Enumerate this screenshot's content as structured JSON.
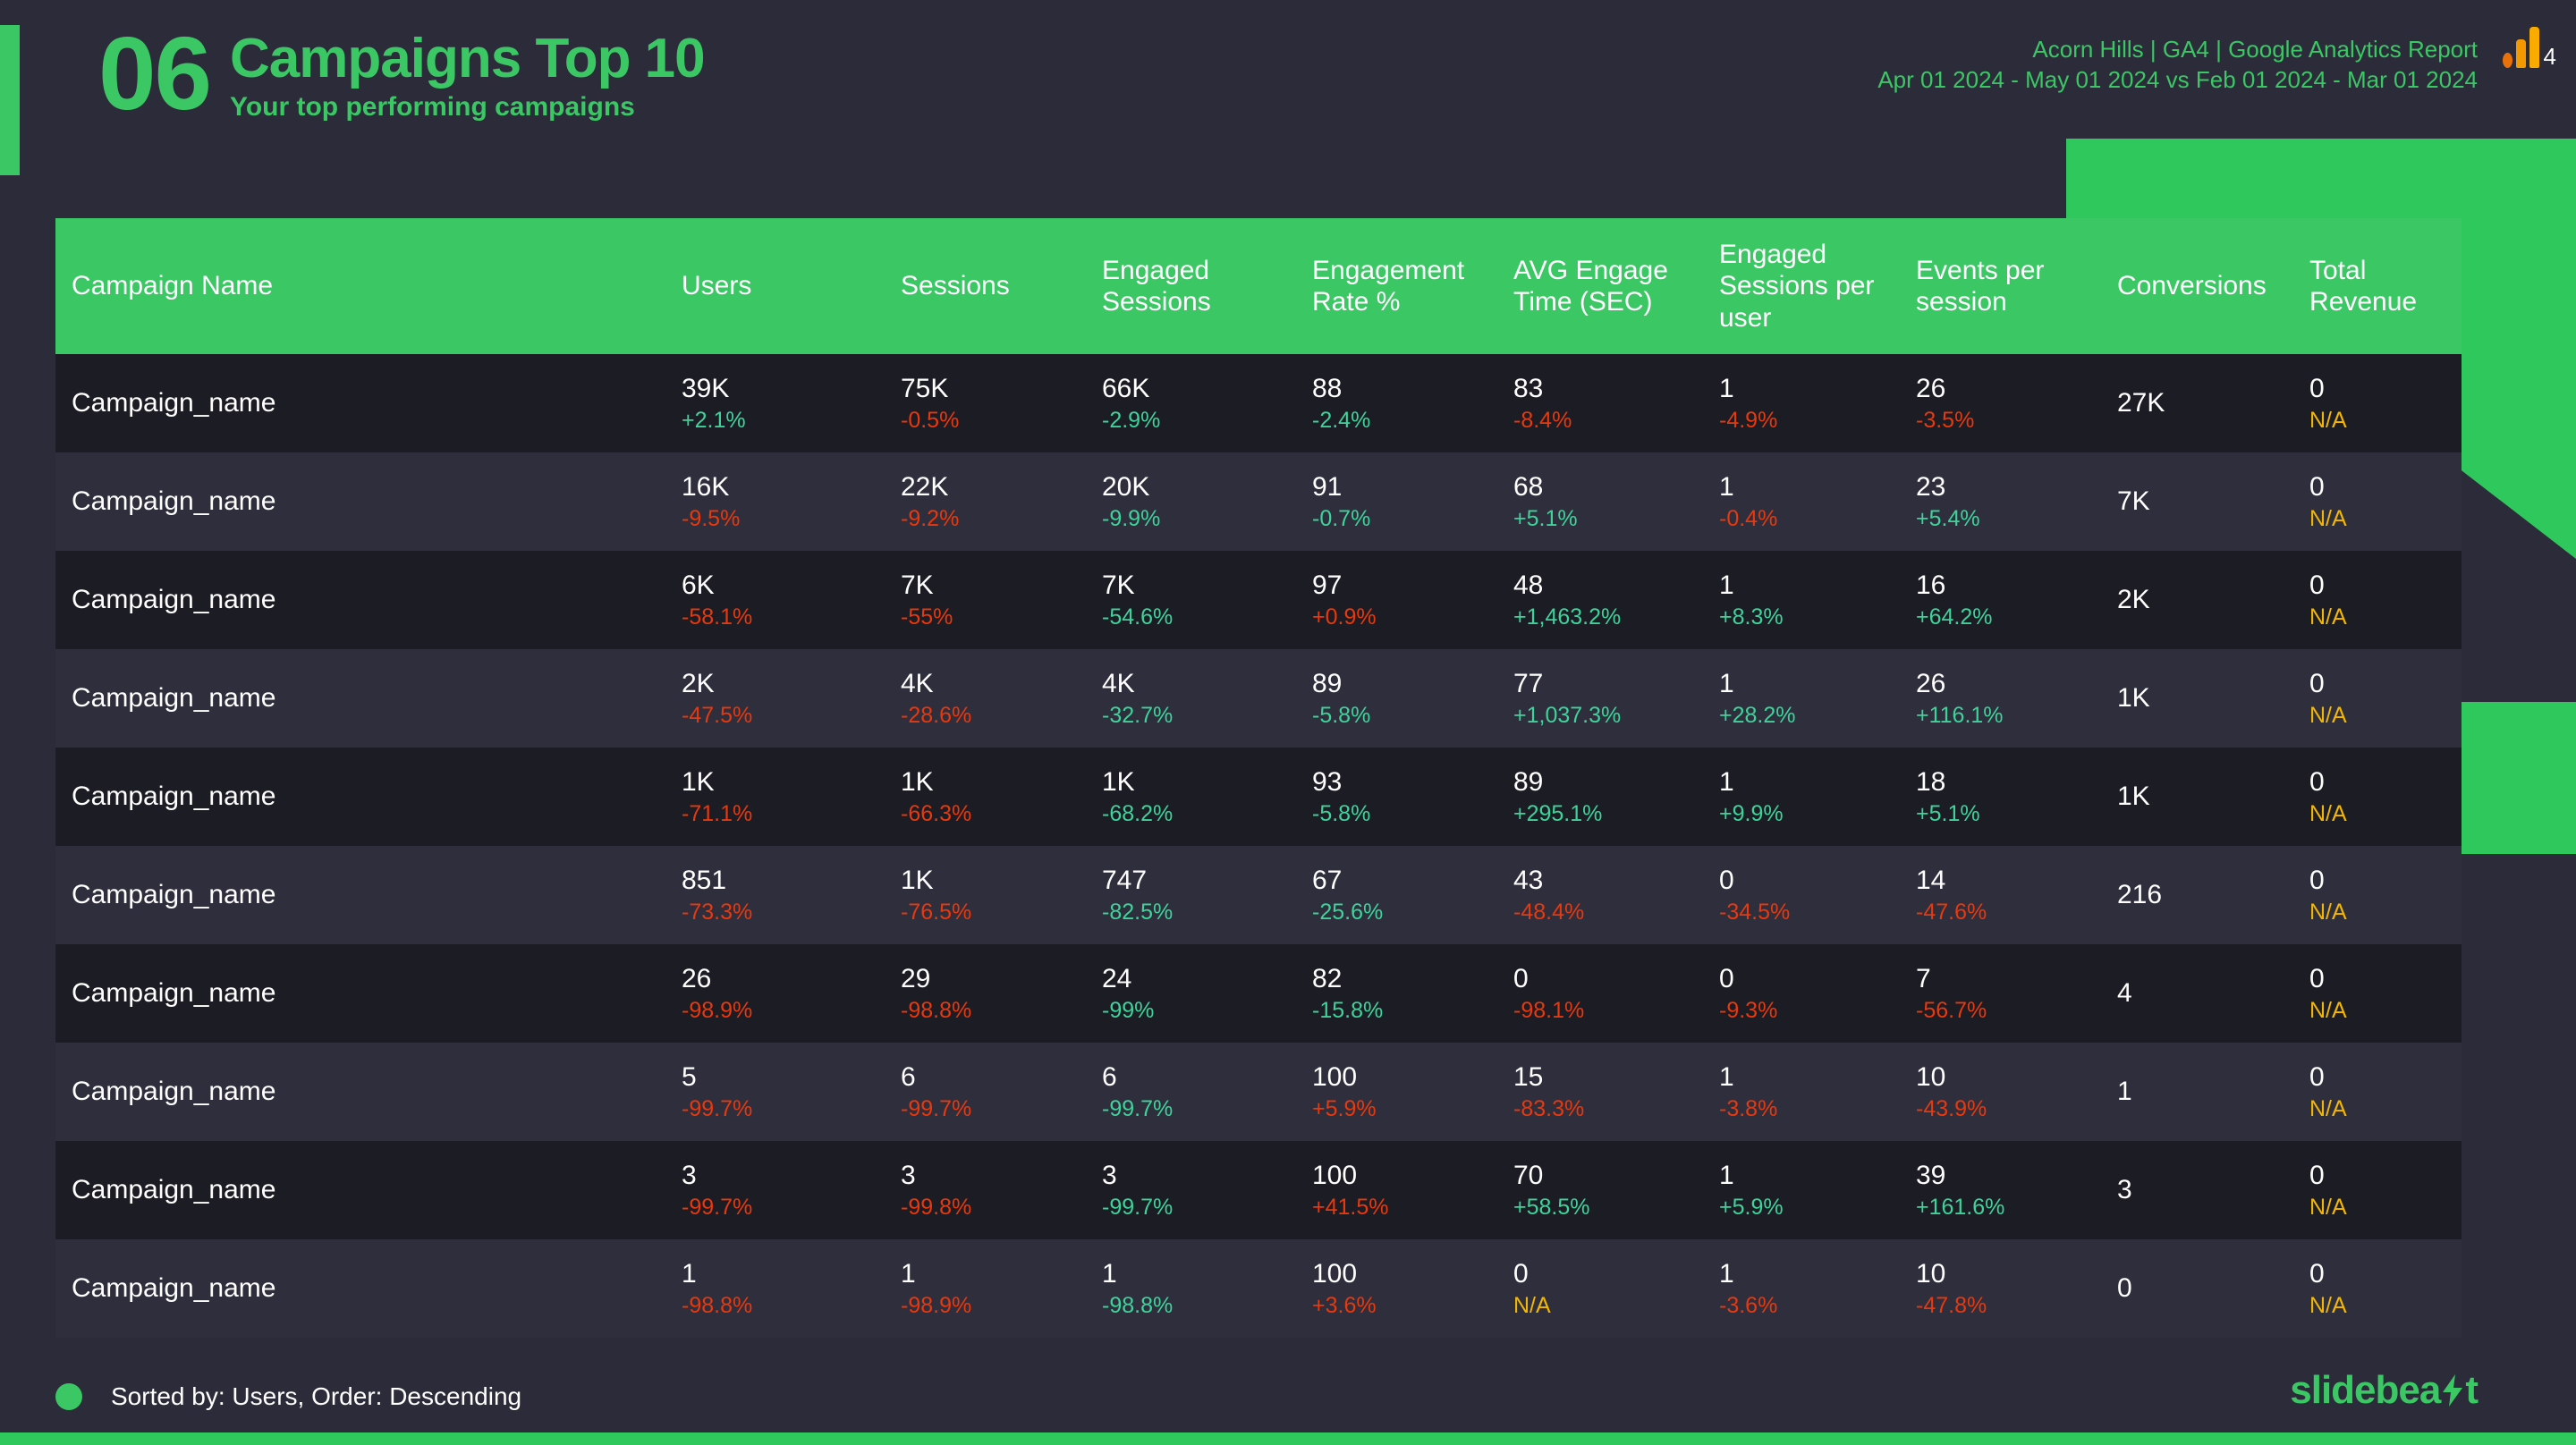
{
  "header": {
    "section_number": "06",
    "title": "Campaigns Top 10",
    "subtitle": "Your top performing campaigns",
    "account_line": "Acorn Hills | GA4 | Google Analytics Report",
    "date_range_line": "Apr 01 2024 - May 01 2024 vs Feb 01 2024 - Mar 01 2024",
    "logo_badge": "4",
    "logo_name": "ga4-logo"
  },
  "table": {
    "columns": [
      "Campaign Name",
      "Users",
      "Sessions",
      "Engaged Sessions",
      "Engagement Rate %",
      "AVG Engage Time (SEC)",
      "Engaged Sessions per user",
      "Events per session",
      "Conversions",
      "Total Revenue"
    ],
    "rows": [
      {
        "name": "Campaign_name",
        "cells": [
          {
            "value": "39K",
            "delta": "+2.1%",
            "dir": "up"
          },
          {
            "value": "75K",
            "delta": "-0.5%",
            "dir": "down"
          },
          {
            "value": "66K",
            "delta": "-2.9%",
            "dir": "up"
          },
          {
            "value": "88",
            "delta": "-2.4%",
            "dir": "up"
          },
          {
            "value": "83",
            "delta": "-8.4%",
            "dir": "down"
          },
          {
            "value": "1",
            "delta": "-4.9%",
            "dir": "down"
          },
          {
            "value": "26",
            "delta": "-3.5%",
            "dir": "down"
          },
          {
            "value": "27K",
            "delta": "",
            "dir": "none"
          },
          {
            "value": "0",
            "delta": "N/A",
            "dir": "na"
          }
        ]
      },
      {
        "name": "Campaign_name",
        "cells": [
          {
            "value": "16K",
            "delta": "-9.5%",
            "dir": "down"
          },
          {
            "value": "22K",
            "delta": "-9.2%",
            "dir": "down"
          },
          {
            "value": "20K",
            "delta": "-9.9%",
            "dir": "up"
          },
          {
            "value": "91",
            "delta": "-0.7%",
            "dir": "up"
          },
          {
            "value": "68",
            "delta": "+5.1%",
            "dir": "up"
          },
          {
            "value": "1",
            "delta": "-0.4%",
            "dir": "down"
          },
          {
            "value": "23",
            "delta": "+5.4%",
            "dir": "up"
          },
          {
            "value": "7K",
            "delta": "",
            "dir": "none"
          },
          {
            "value": "0",
            "delta": "N/A",
            "dir": "na"
          }
        ]
      },
      {
        "name": "Campaign_name",
        "cells": [
          {
            "value": "6K",
            "delta": "-58.1%",
            "dir": "down"
          },
          {
            "value": "7K",
            "delta": "-55%",
            "dir": "down"
          },
          {
            "value": "7K",
            "delta": "-54.6%",
            "dir": "up"
          },
          {
            "value": "97",
            "delta": "+0.9%",
            "dir": "down"
          },
          {
            "value": "48",
            "delta": "+1,463.2%",
            "dir": "up"
          },
          {
            "value": "1",
            "delta": "+8.3%",
            "dir": "up"
          },
          {
            "value": "16",
            "delta": "+64.2%",
            "dir": "up"
          },
          {
            "value": "2K",
            "delta": "",
            "dir": "none"
          },
          {
            "value": "0",
            "delta": "N/A",
            "dir": "na"
          }
        ]
      },
      {
        "name": "Campaign_name",
        "cells": [
          {
            "value": "2K",
            "delta": "-47.5%",
            "dir": "down"
          },
          {
            "value": "4K",
            "delta": "-28.6%",
            "dir": "down"
          },
          {
            "value": "4K",
            "delta": "-32.7%",
            "dir": "up"
          },
          {
            "value": "89",
            "delta": "-5.8%",
            "dir": "up"
          },
          {
            "value": "77",
            "delta": "+1,037.3%",
            "dir": "up"
          },
          {
            "value": "1",
            "delta": "+28.2%",
            "dir": "up"
          },
          {
            "value": "26",
            "delta": "+116.1%",
            "dir": "up"
          },
          {
            "value": "1K",
            "delta": "",
            "dir": "none"
          },
          {
            "value": "0",
            "delta": "N/A",
            "dir": "na"
          }
        ]
      },
      {
        "name": "Campaign_name",
        "cells": [
          {
            "value": "1K",
            "delta": "-71.1%",
            "dir": "down"
          },
          {
            "value": "1K",
            "delta": "-66.3%",
            "dir": "down"
          },
          {
            "value": "1K",
            "delta": "-68.2%",
            "dir": "up"
          },
          {
            "value": "93",
            "delta": "-5.8%",
            "dir": "up"
          },
          {
            "value": "89",
            "delta": "+295.1%",
            "dir": "up"
          },
          {
            "value": "1",
            "delta": "+9.9%",
            "dir": "up"
          },
          {
            "value": "18",
            "delta": "+5.1%",
            "dir": "up"
          },
          {
            "value": "1K",
            "delta": "",
            "dir": "none"
          },
          {
            "value": "0",
            "delta": "N/A",
            "dir": "na"
          }
        ]
      },
      {
        "name": "Campaign_name",
        "cells": [
          {
            "value": "851",
            "delta": "-73.3%",
            "dir": "down"
          },
          {
            "value": "1K",
            "delta": "-76.5%",
            "dir": "down"
          },
          {
            "value": "747",
            "delta": "-82.5%",
            "dir": "up"
          },
          {
            "value": "67",
            "delta": "-25.6%",
            "dir": "up"
          },
          {
            "value": "43",
            "delta": "-48.4%",
            "dir": "down"
          },
          {
            "value": "0",
            "delta": "-34.5%",
            "dir": "down"
          },
          {
            "value": "14",
            "delta": "-47.6%",
            "dir": "down"
          },
          {
            "value": "216",
            "delta": "",
            "dir": "none"
          },
          {
            "value": "0",
            "delta": "N/A",
            "dir": "na"
          }
        ]
      },
      {
        "name": "Campaign_name",
        "cells": [
          {
            "value": "26",
            "delta": "-98.9%",
            "dir": "down"
          },
          {
            "value": "29",
            "delta": "-98.8%",
            "dir": "down"
          },
          {
            "value": "24",
            "delta": "-99%",
            "dir": "up"
          },
          {
            "value": "82",
            "delta": "-15.8%",
            "dir": "up"
          },
          {
            "value": "0",
            "delta": "-98.1%",
            "dir": "down"
          },
          {
            "value": "0",
            "delta": "-9.3%",
            "dir": "down"
          },
          {
            "value": "7",
            "delta": "-56.7%",
            "dir": "down"
          },
          {
            "value": "4",
            "delta": "",
            "dir": "none"
          },
          {
            "value": "0",
            "delta": "N/A",
            "dir": "na"
          }
        ]
      },
      {
        "name": "Campaign_name",
        "cells": [
          {
            "value": "5",
            "delta": "-99.7%",
            "dir": "down"
          },
          {
            "value": "6",
            "delta": "-99.7%",
            "dir": "down"
          },
          {
            "value": "6",
            "delta": "-99.7%",
            "dir": "up"
          },
          {
            "value": "100",
            "delta": "+5.9%",
            "dir": "down"
          },
          {
            "value": "15",
            "delta": "-83.3%",
            "dir": "down"
          },
          {
            "value": "1",
            "delta": "-3.8%",
            "dir": "down"
          },
          {
            "value": "10",
            "delta": "-43.9%",
            "dir": "down"
          },
          {
            "value": "1",
            "delta": "",
            "dir": "none"
          },
          {
            "value": "0",
            "delta": "N/A",
            "dir": "na"
          }
        ]
      },
      {
        "name": "Campaign_name",
        "cells": [
          {
            "value": "3",
            "delta": "-99.7%",
            "dir": "down"
          },
          {
            "value": "3",
            "delta": "-99.8%",
            "dir": "down"
          },
          {
            "value": "3",
            "delta": "-99.7%",
            "dir": "up"
          },
          {
            "value": "100",
            "delta": "+41.5%",
            "dir": "down"
          },
          {
            "value": "70",
            "delta": "+58.5%",
            "dir": "up"
          },
          {
            "value": "1",
            "delta": "+5.9%",
            "dir": "up"
          },
          {
            "value": "39",
            "delta": "+161.6%",
            "dir": "up"
          },
          {
            "value": "3",
            "delta": "",
            "dir": "none"
          },
          {
            "value": "0",
            "delta": "N/A",
            "dir": "na"
          }
        ]
      },
      {
        "name": "Campaign_name",
        "cells": [
          {
            "value": "1",
            "delta": "-98.8%",
            "dir": "down"
          },
          {
            "value": "1",
            "delta": "-98.9%",
            "dir": "down"
          },
          {
            "value": "1",
            "delta": "-98.8%",
            "dir": "up"
          },
          {
            "value": "100",
            "delta": "+3.6%",
            "dir": "down"
          },
          {
            "value": "0",
            "delta": "N/A",
            "dir": "na"
          },
          {
            "value": "1",
            "delta": "-3.6%",
            "dir": "down"
          },
          {
            "value": "10",
            "delta": "-47.8%",
            "dir": "down"
          },
          {
            "value": "0",
            "delta": "",
            "dir": "none"
          },
          {
            "value": "0",
            "delta": "N/A",
            "dir": "na"
          }
        ]
      }
    ]
  },
  "footer": {
    "sort_text": "Sorted by: Users, Order: Descending",
    "brand_part1": "slidebea",
    "brand_part2": "t"
  },
  "colors": {
    "brand_green": "#3cc765",
    "header_green": "#3cc765",
    "background": "#2b2b3a",
    "row_odd": "#1c1c24",
    "row_even": "#2e2e3d",
    "delta_up": "#3fd39a",
    "delta_down": "#e8380d",
    "delta_na": "#f2b705"
  }
}
